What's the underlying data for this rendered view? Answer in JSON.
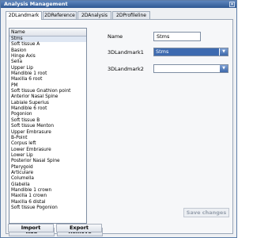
{
  "window": {
    "title": "Analysis Management",
    "close_glyph": "×"
  },
  "tabs": [
    {
      "label": "2DLandmark",
      "active": true
    },
    {
      "label": "2DReference",
      "active": false
    },
    {
      "label": "2DAnalysis",
      "active": false
    },
    {
      "label": "2DProfileline",
      "active": false
    }
  ],
  "list": {
    "header": "Name",
    "items": [
      "Stms",
      "Soft tissue A",
      "Basion",
      "Hinge Axis",
      "Sella",
      "Upper Lip",
      "Mandible 1 root",
      "Maxilla 6 root",
      "PM",
      "Soft tissue Gnathion point",
      "Anterior Nasal Spine",
      "Labiale Superius",
      "Mandible 6 root",
      "Pogonion",
      "Soft tissue B",
      "Soft tissue Menton",
      "Upper Embrasure",
      "B-Point",
      "Corpus left",
      "Lower Embrasure",
      "Lower Lip",
      "Posterior Nasal Spine",
      "Pterygoid",
      "Articulare",
      "Columella",
      "Glabella",
      "Mandible 1 crown",
      "Maxilla 1 crown",
      "Maxilla 6 distal",
      "Soft tissue Pogonion"
    ]
  },
  "buttons": {
    "add": "Add",
    "remove": "Remove",
    "import": "Import",
    "export": "Export",
    "save": "Save changes"
  },
  "form": {
    "name_label": "Name",
    "name_value": "Stms",
    "landmark1_label": "3DLandmark1",
    "landmark1_value": "Stms",
    "landmark2_label": "3DLandmark2",
    "landmark2_value": ""
  },
  "icons": {
    "dropdown_arrow": "▼"
  },
  "colors": {
    "titlebar": "#3d68aa",
    "selection": "#3d6ab0"
  }
}
